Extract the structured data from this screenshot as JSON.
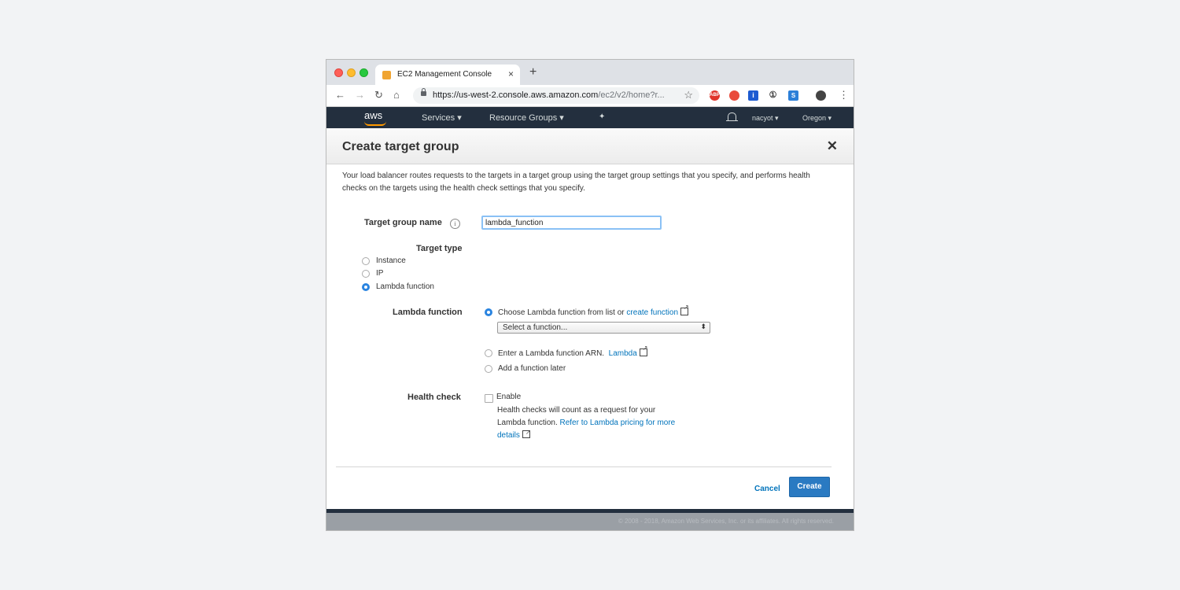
{
  "browser": {
    "tab_title": "EC2 Management Console",
    "tab_close": "×",
    "new_tab": "+",
    "url_main": "https://us-west-2.console.aws.amazon.com",
    "url_path": "/ec2/v2/home?r...",
    "extensions": [
      {
        "name": "abp",
        "text": "ABP",
        "color": "#e0352b"
      },
      {
        "name": "chrome-ext",
        "text": "",
        "color": "#e94b3c"
      },
      {
        "name": "info-ext",
        "text": "i",
        "color": "#1d5bd1"
      },
      {
        "name": "onepassword",
        "text": "①",
        "color": "#3a3a3a"
      },
      {
        "name": "skype-ext",
        "text": "S",
        "color": "#2c7fd8"
      }
    ]
  },
  "aws_nav": {
    "logo": "aws",
    "services": "Services ▾",
    "resource_groups": "Resource Groups ▾",
    "pin": "✦",
    "user": "nacyot ▾",
    "region": "Oregon ▾"
  },
  "modal": {
    "title": "Create target group",
    "close": "✕",
    "description": "Your load balancer routes requests to the targets in a target group using the target group settings that you specify, and performs health checks on the targets using the health check settings that you specify.",
    "target_group_name_label": "Target group name",
    "info_icon": "i",
    "target_group_name_value": "lambda_function",
    "target_type_label": "Target type",
    "target_types": [
      "Instance",
      "IP",
      "Lambda function"
    ],
    "target_type_selected": "Lambda function",
    "lambda_function_label": "Lambda function",
    "choose_option": "Choose Lambda function from list or ",
    "create_function_link": "create function",
    "select_placeholder": "Select a function...",
    "select_arrow": "⬍",
    "arn_option": "Enter a Lambda function ARN.",
    "lambda_link": "Lambda",
    "later_option": "Add a function later",
    "health_check_label": "Health check",
    "enable_label": "Enable",
    "health_help_1": "Health checks will count as a request for your",
    "health_help_2": "Lambda function.",
    "pricing_link_1": "Refer to Lambda pricing for more",
    "pricing_link_2": "details",
    "cancel": "Cancel",
    "create": "Create"
  },
  "footer": {
    "copyright": "© 2008 - 2018, Amazon Web Services, Inc. or its affiliates. All rights reserved."
  },
  "colors": {
    "accent": "#2a7ac2",
    "link": "#0073bb",
    "aws_nav": "#232f3e",
    "aws_orange": "#ff9900"
  }
}
